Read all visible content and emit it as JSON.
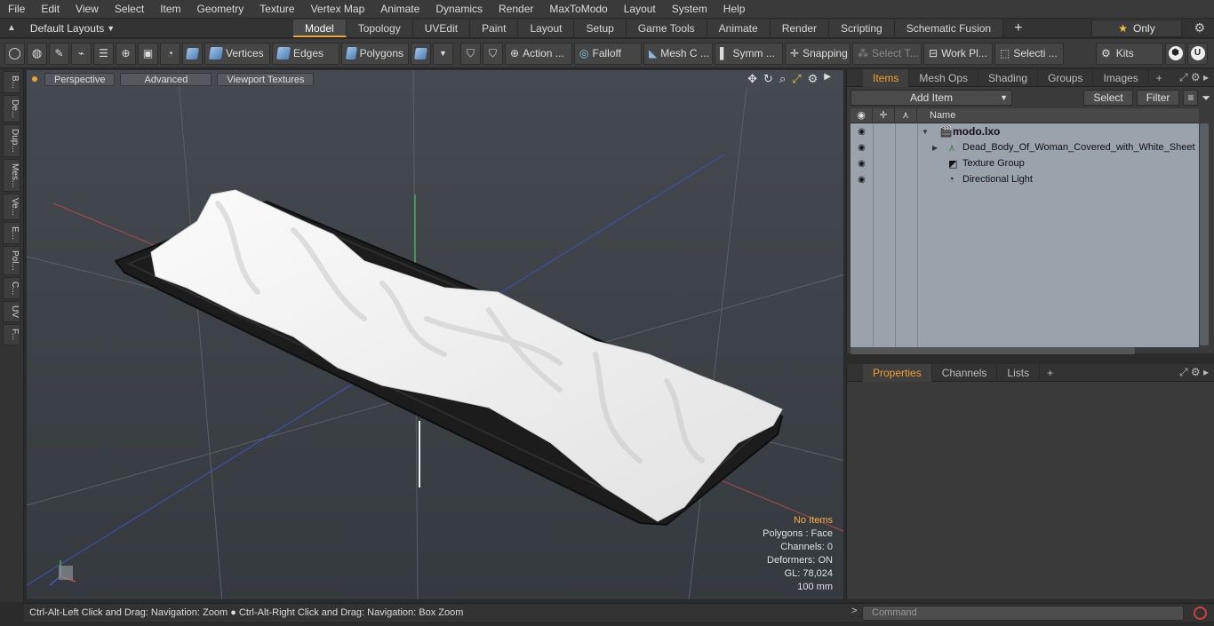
{
  "menu": [
    "File",
    "Edit",
    "View",
    "Select",
    "Item",
    "Geometry",
    "Texture",
    "Vertex Map",
    "Animate",
    "Dynamics",
    "Render",
    "MaxToModo",
    "Layout",
    "System",
    "Help"
  ],
  "layout_selector": "Default Layouts",
  "layout_tabs": [
    "Model",
    "Topology",
    "UVEdit",
    "Paint",
    "Layout",
    "Setup",
    "Game Tools",
    "Animate",
    "Render",
    "Scripting",
    "Schematic Fusion"
  ],
  "active_tab": "Model",
  "only_label": "Only",
  "toolbar": {
    "vertices": "Vertices",
    "edges": "Edges",
    "polygons": "Polygons",
    "action": "Action ...",
    "falloff": "Falloff",
    "mesh": "Mesh C ...",
    "symm": "Symm ...",
    "snapping": "Snapping",
    "select_t": "Select T...",
    "work_plane": "Work Pl...",
    "selection": "Selecti ...",
    "kits": "Kits"
  },
  "left_tabs": [
    "B...",
    "De...",
    "Dup...",
    "Mes...",
    "Ve...",
    "E...",
    "Pol...",
    "C...",
    "UV",
    "F..."
  ],
  "viewport": {
    "perspective": "Perspective",
    "advanced": "Advanced",
    "textures": "Viewport Textures",
    "info": {
      "no_items": "No Items",
      "polygons": "Polygons : Face",
      "channels": "Channels: 0",
      "deformers": "Deformers: ON",
      "gl": "GL: 78,024",
      "scale": "100 mm"
    }
  },
  "status_text": "Ctrl-Alt-Left Click and Drag: Navigation: Zoom ● Ctrl-Alt-Right Click and Drag: Navigation: Box Zoom",
  "items_panel": {
    "tabs": [
      "Items",
      "Mesh Ops",
      "Shading",
      "Groups",
      "Images"
    ],
    "add_item": "Add Item",
    "select": "Select",
    "filter": "Filter",
    "name_header": "Name",
    "tree": [
      {
        "label": "modo.lxo"
      },
      {
        "label": "Dead_Body_Of_Woman_Covered_with_White_Sheet"
      },
      {
        "label": "Texture Group"
      },
      {
        "label": "Directional Light"
      }
    ]
  },
  "properties_panel": {
    "tabs": [
      "Properties",
      "Channels",
      "Lists"
    ]
  },
  "command_placeholder": "Command"
}
